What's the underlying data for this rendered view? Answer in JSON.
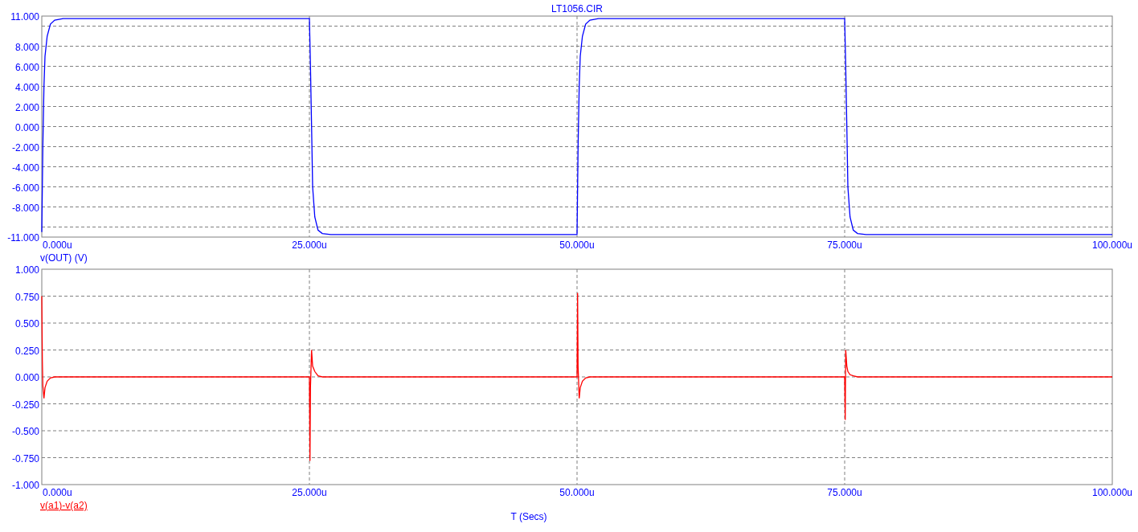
{
  "charts": [
    {
      "legend": {
        "selected": false
      },
      "chart_data": {
        "type": "line",
        "title": "LT1056.CIR",
        "grid": true,
        "xlim": [
          0,
          100
        ],
        "ylim": [
          -11,
          11
        ],
        "xticks": [
          {
            "value": 0,
            "label": "0.000u"
          },
          {
            "value": 25,
            "label": "25.000u"
          },
          {
            "value": 50,
            "label": "50.000u"
          },
          {
            "value": 75,
            "label": "75.000u"
          },
          {
            "value": 100,
            "label": "100.000u"
          }
        ],
        "yticks": [
          {
            "value": 11,
            "label": "11.000"
          },
          {
            "value": 8,
            "label": "8.000"
          },
          {
            "value": 6,
            "label": "6.000"
          },
          {
            "value": 4,
            "label": "4.000"
          },
          {
            "value": 2,
            "label": "2.000"
          },
          {
            "value": 0,
            "label": "0.000"
          },
          {
            "value": -2,
            "label": "-2.000"
          },
          {
            "value": -4,
            "label": "-4.000"
          },
          {
            "value": -6,
            "label": "-6.000"
          },
          {
            "value": -8,
            "label": "-8.000"
          },
          {
            "value": -11,
            "label": "-11.000"
          }
        ],
        "x": [
          0,
          0.1,
          0.2,
          0.3,
          0.5,
          0.8,
          1.2,
          2,
          25,
          25.1,
          25.2,
          25.3,
          25.5,
          25.8,
          26.2,
          27,
          50,
          50.1,
          50.2,
          50.3,
          50.5,
          50.8,
          51.2,
          52,
          75,
          75.1,
          75.2,
          75.3,
          75.5,
          75.8,
          76.2,
          77,
          100
        ],
        "series": [
          {
            "name": "v(OUT) (V)",
            "color": "#0000ff",
            "values": [
              -10.5,
              -2,
              4,
              7,
              9,
              10.2,
              10.6,
              10.75,
              10.75,
              6,
              0,
              -6,
              -9,
              -10.3,
              -10.65,
              -10.75,
              -10.75,
              -2,
              4,
              7,
              9,
              10.2,
              10.6,
              10.75,
              10.75,
              6,
              0,
              -6,
              -9,
              -10.3,
              -10.65,
              -10.75,
              -10.75
            ]
          }
        ]
      }
    },
    {
      "legend": {
        "selected": true
      },
      "chart_data": {
        "type": "line",
        "xlabel": "T (Secs)",
        "grid": true,
        "xlim": [
          0,
          100
        ],
        "ylim": [
          -1,
          1
        ],
        "xticks": [
          {
            "value": 0,
            "label": "0.000u"
          },
          {
            "value": 25,
            "label": "25.000u"
          },
          {
            "value": 50,
            "label": "50.000u"
          },
          {
            "value": 75,
            "label": "75.000u"
          },
          {
            "value": 100,
            "label": "100.000u"
          }
        ],
        "yticks": [
          {
            "value": 1,
            "label": "1.000"
          },
          {
            "value": 0.75,
            "label": "0.750"
          },
          {
            "value": 0.5,
            "label": "0.500"
          },
          {
            "value": 0.25,
            "label": "0.250"
          },
          {
            "value": 0,
            "label": "0.000"
          },
          {
            "value": -0.25,
            "label": "-0.250"
          },
          {
            "value": -0.5,
            "label": "-0.500"
          },
          {
            "value": -0.75,
            "label": "-0.750"
          },
          {
            "value": -1,
            "label": "-1.000"
          }
        ],
        "x": [
          0,
          0.05,
          0.1,
          0.2,
          0.3,
          0.5,
          0.8,
          1.2,
          25,
          25.05,
          25.1,
          25.2,
          25.3,
          25.5,
          25.8,
          26.2,
          50,
          50.05,
          50.1,
          50.2,
          50.3,
          50.5,
          50.8,
          51.2,
          75,
          75.05,
          75.1,
          75.2,
          75.3,
          75.5,
          75.8,
          76.2,
          100
        ],
        "series": [
          {
            "name": "v(a1)-v(a2)",
            "color": "#ff0000",
            "values": [
              0.75,
              0.15,
              -0.08,
              -0.2,
              -0.1,
              -0.04,
              -0.01,
              0,
              0,
              -0.78,
              -0.1,
              0.25,
              0.1,
              0.05,
              0.01,
              0,
              0,
              0.78,
              0.1,
              -0.2,
              -0.1,
              -0.04,
              -0.01,
              0,
              0,
              -0.4,
              0.25,
              0.1,
              0.05,
              0.02,
              0.01,
              0,
              0
            ]
          }
        ]
      }
    }
  ]
}
